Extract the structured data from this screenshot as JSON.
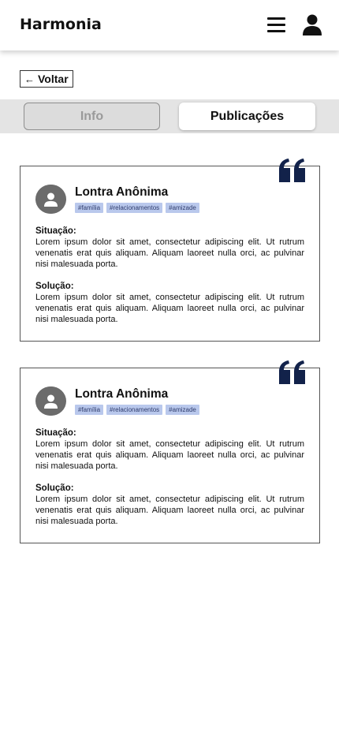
{
  "header": {
    "brand": "Harmonia",
    "menu_icon": "hamburger-menu-icon",
    "user_icon": "user-icon"
  },
  "back_button": {
    "label": "Voltar",
    "icon": "arrow-left-icon"
  },
  "tabs": [
    {
      "label": "Info",
      "active": false
    },
    {
      "label": "Publicações",
      "active": true
    }
  ],
  "colors": {
    "quote": "#12224a",
    "tag_bg": "#b9c8ec",
    "avatar": "#6b6b6b",
    "tabs_bar": "#e4e4e4"
  },
  "posts": [
    {
      "author": "Lontra Anônima",
      "tags": [
        "#família",
        "#relacionamentos",
        "#amizade"
      ],
      "situacao_label": "Situação:",
      "situacao_text": "Lorem ipsum dolor sit amet, consectetur adipiscing elit. Ut rutrum venenatis erat quis aliquam. Aliquam laoreet nulla orci, ac pulvinar nisi malesuada porta.",
      "solucao_label": "Solução:",
      "solucao_text": "Lorem ipsum dolor sit amet, consectetur adipiscing elit. Ut rutrum venenatis erat quis aliquam. Aliquam laoreet nulla orci, ac pulvinar nisi malesuada porta."
    },
    {
      "author": "Lontra Anônima",
      "tags": [
        "#família",
        "#relacionamentos",
        "#amizade"
      ],
      "situacao_label": "Situação:",
      "situacao_text": "Lorem ipsum dolor sit amet, consectetur adipiscing elit. Ut rutrum venenatis erat quis aliquam. Aliquam laoreet nulla orci, ac pulvinar nisi malesuada porta.",
      "solucao_label": "Solução:",
      "solucao_text": "Lorem ipsum dolor sit amet, consectetur adipiscing elit. Ut rutrum venenatis erat quis aliquam. Aliquam laoreet nulla orci, ac pulvinar nisi malesuada porta."
    }
  ]
}
